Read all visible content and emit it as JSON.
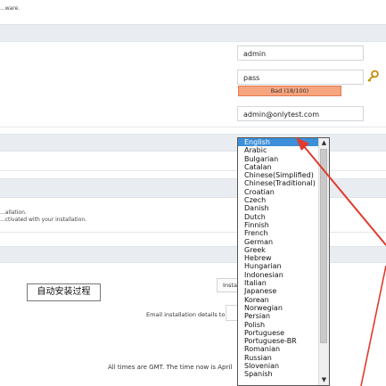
{
  "header": {
    "top_text": "...ware."
  },
  "admin": {
    "username_value": "admin",
    "password_value": "pass",
    "strength_label": "Bad (18/100)",
    "email_value": "admin@onlytest.com"
  },
  "language": {
    "selected": "English",
    "options": [
      "English",
      "Arabic",
      "Bulgarian",
      "Catalan",
      "Chinese(Simplified)",
      "Chinese(Traditional)",
      "Croatian",
      "Czech",
      "Danish",
      "Dutch",
      "Finnish",
      "French",
      "German",
      "Greek",
      "Hebrew",
      "Hungarian",
      "Indonesian",
      "Italian",
      "Japanese",
      "Korean",
      "Norwegian",
      "Persian",
      "Polish",
      "Portuguese",
      "Portuguese-BR",
      "Romanian",
      "Russian",
      "Slovenian",
      "Spanish"
    ]
  },
  "notes": {
    "line1": "...allation.",
    "line2": "...ctivated with your installation."
  },
  "install": {
    "button_label": "Install",
    "email_label": "Email installation details to :",
    "chinese_caption": "自动安装过程"
  },
  "footer": {
    "text": "All times are GMT. The time now is April"
  },
  "colors": {
    "accent": "#3c8fd8",
    "strength": "#f7a57f",
    "arrow": "#e23b2e",
    "bar": "#e9edf2"
  }
}
